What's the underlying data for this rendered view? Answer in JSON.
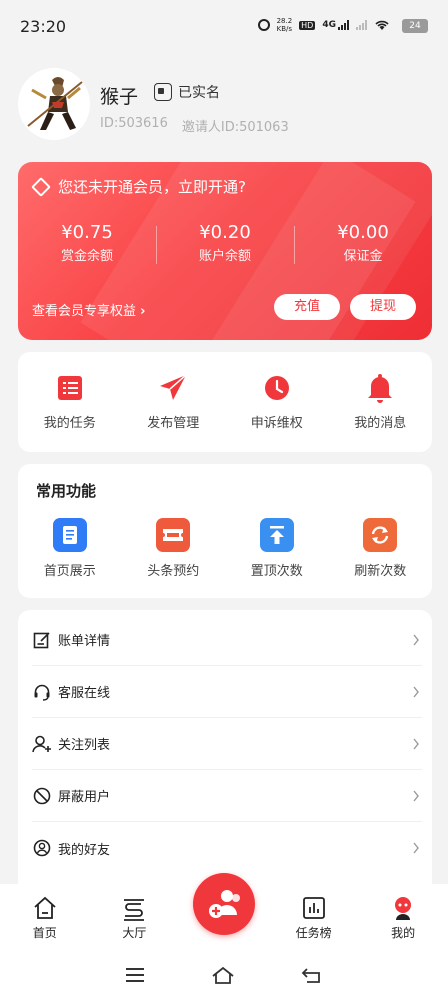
{
  "status": {
    "time": "23:20",
    "net_speed": "28.2",
    "net_unit": "KB/s",
    "hd": "HD",
    "net_type": "4G",
    "battery": "24"
  },
  "profile": {
    "name": "猴子",
    "verified": "已实名",
    "user_id": "ID:503616",
    "inviter_id": "邀请人ID:501063"
  },
  "vip": {
    "title": "您还未开通会员，立即开通?",
    "balances": [
      {
        "amount": "¥0.75",
        "label": "赏金余额"
      },
      {
        "amount": "¥0.20",
        "label": "账户余额"
      },
      {
        "amount": "¥0.00",
        "label": "保证金"
      }
    ],
    "benefits_link": "查看会员专享权益",
    "recharge_label": "充值",
    "withdraw_label": "提现"
  },
  "quick_actions": [
    {
      "label": "我的任务",
      "icon": "task-list-icon"
    },
    {
      "label": "发布管理",
      "icon": "paper-plane-icon"
    },
    {
      "label": "申诉维权",
      "icon": "clock-icon"
    },
    {
      "label": "我的消息",
      "icon": "bell-icon"
    }
  ],
  "features": {
    "heading": "常用功能",
    "items": [
      {
        "label": "首页展示",
        "icon": "document-icon",
        "color": "#2f7cf6"
      },
      {
        "label": "头条预约",
        "icon": "ticket-icon",
        "color": "#ef5a3c"
      },
      {
        "label": "置顶次数",
        "icon": "arrow-top-icon",
        "color": "#3a90f0"
      },
      {
        "label": "刷新次数",
        "icon": "refresh-icon",
        "color": "#ef6a3a"
      }
    ]
  },
  "menu": [
    {
      "label": "账单详情",
      "icon": "edit-icon"
    },
    {
      "label": "客服在线",
      "icon": "headset-icon"
    },
    {
      "label": "关注列表",
      "icon": "add-user-icon"
    },
    {
      "label": "屏蔽用户",
      "icon": "block-icon"
    },
    {
      "label": "我的好友",
      "icon": "friend-icon"
    }
  ],
  "tabbar": [
    {
      "label": "首页",
      "icon": "home-icon"
    },
    {
      "label": "大厅",
      "icon": "hall-icon"
    },
    {
      "label": "",
      "icon": "publish-users-icon"
    },
    {
      "label": "任务榜",
      "icon": "chart-icon"
    },
    {
      "label": "我的",
      "icon": "profile-icon"
    }
  ],
  "colors": {
    "accent": "#f0383c",
    "background": "#f3f3f3"
  }
}
